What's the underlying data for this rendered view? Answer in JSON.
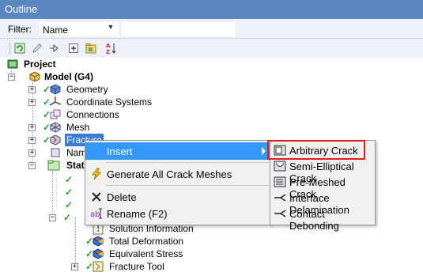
{
  "window": {
    "title": "Outline"
  },
  "filter": {
    "label": "Filter:",
    "selected": "Name",
    "search_value": ""
  },
  "toolbar": {
    "icons": [
      "refresh-icon",
      "edit-icon",
      "sync-icon",
      "expand-all-icon",
      "folder-icon",
      "sort-icon"
    ]
  },
  "tree": {
    "project": "Project",
    "model": "Model (G4)",
    "geometry": "Geometry",
    "coordinate_systems": "Coordinate Systems",
    "connections": "Connections",
    "mesh": "Mesh",
    "fracture": "Fracture",
    "named_selections": "Name",
    "static_structural": "Stat",
    "solution_information": "Solution Information",
    "total_deformation": "Total Deformation",
    "equivalent_stress": "Equivalent Stress",
    "fracture_tool": "Fracture Tool"
  },
  "context_menu": {
    "insert": "Insert",
    "generate": "Generate All Crack Meshes",
    "delete": "Delete",
    "rename": "Rename (F2)"
  },
  "submenu": {
    "items": [
      "Arbitrary Crack",
      "Semi-Elliptical Crack",
      "Pre-Meshed Crack",
      "Interface Delamination",
      "Contact Debonding"
    ]
  },
  "colors": {
    "titlebar": "#5b86c2",
    "selection": "#3399ff",
    "highlight_border": "#e02020",
    "check": "#2e9e2e"
  }
}
